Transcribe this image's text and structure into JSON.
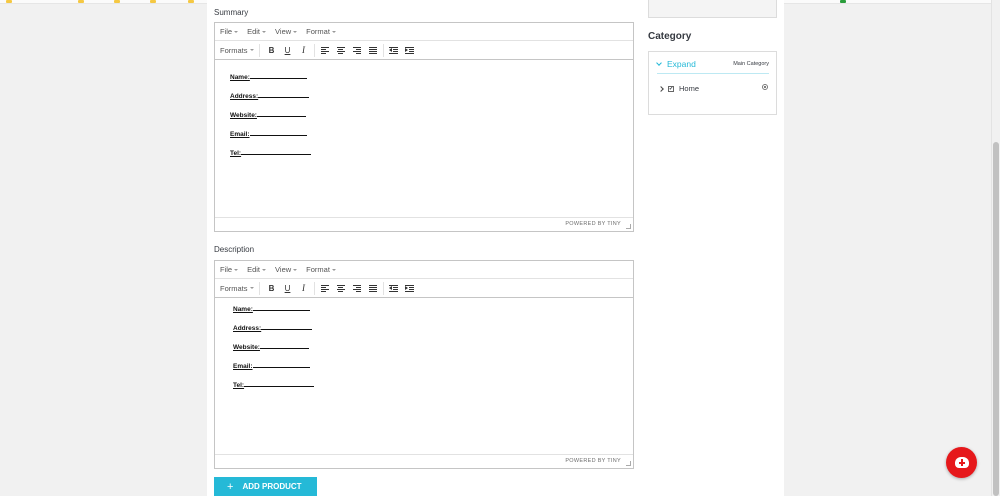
{
  "summary": {
    "label": "Summary",
    "editor": {
      "menu": [
        "File",
        "Edit",
        "View",
        "Format"
      ],
      "formats_label": "Formats",
      "toolbar": {
        "bold": "B",
        "underline": "U",
        "italic": "I"
      },
      "lines": [
        {
          "label": "Name:"
        },
        {
          "label": "Address:"
        },
        {
          "label": "Website:"
        },
        {
          "label": "Email:"
        },
        {
          "label": "Tel:"
        }
      ],
      "powered_by": "POWERED BY TINY"
    }
  },
  "description": {
    "label": "Description",
    "editor": {
      "menu": [
        "File",
        "Edit",
        "View",
        "Format"
      ],
      "formats_label": "Formats",
      "toolbar": {
        "bold": "B",
        "underline": "U",
        "italic": "I"
      },
      "lines": [
        {
          "label": "Name:"
        },
        {
          "label": "Address:"
        },
        {
          "label": "Website:"
        },
        {
          "label": "Email:"
        },
        {
          "label": "Tel:"
        }
      ],
      "powered_by": "POWERED BY TINY"
    }
  },
  "add_product": {
    "label": "ADD PRODUCT",
    "icon": "plus-icon"
  },
  "category": {
    "title": "Category",
    "expand_label": "Expand",
    "main_category_label": "Main Category",
    "tree": [
      {
        "label": "Home",
        "checked": true,
        "main": true
      }
    ]
  },
  "colors": {
    "accent": "#25b9d7",
    "fab": "#e6181b",
    "page_bg": "#f1f1f1"
  },
  "fab": {
    "icon": "cloud-plus-icon"
  }
}
